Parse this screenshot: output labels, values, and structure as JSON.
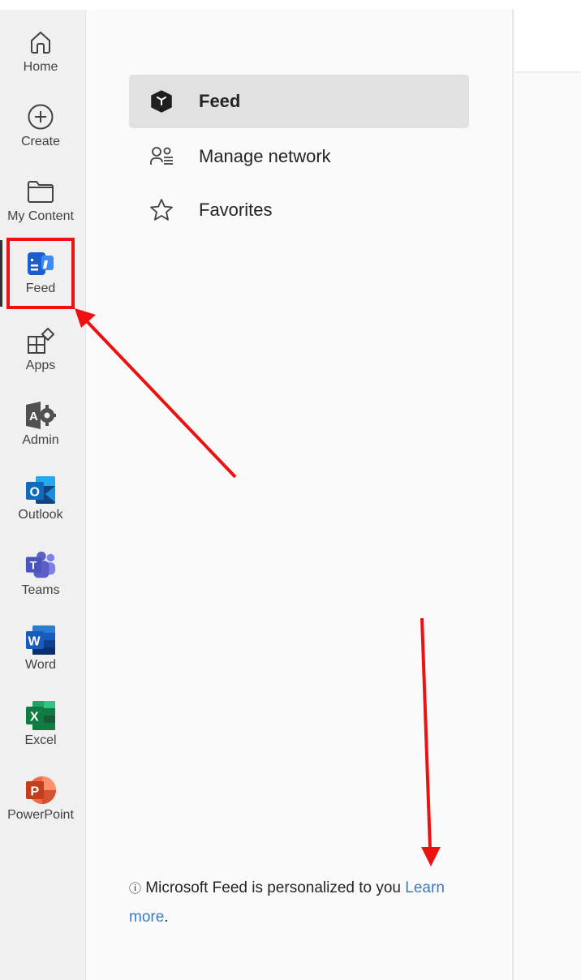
{
  "rail": {
    "items": [
      {
        "label": "Home",
        "icon": "home-icon"
      },
      {
        "label": "Create",
        "icon": "add-circle-icon"
      },
      {
        "label": "My Content",
        "icon": "folder-icon"
      },
      {
        "label": "Feed",
        "icon": "feed-icon"
      },
      {
        "label": "Apps",
        "icon": "apps-icon"
      },
      {
        "label": "Admin",
        "icon": "admin-icon"
      },
      {
        "label": "Outlook",
        "icon": "outlook-icon"
      },
      {
        "label": "Teams",
        "icon": "teams-icon"
      },
      {
        "label": "Word",
        "icon": "word-icon"
      },
      {
        "label": "Excel",
        "icon": "excel-icon"
      },
      {
        "label": "PowerPoint",
        "icon": "powerpoint-icon"
      }
    ],
    "active": "Feed"
  },
  "panel": {
    "items": [
      {
        "label": "Feed",
        "icon": "cube-icon"
      },
      {
        "label": "Manage network",
        "icon": "people-list-icon"
      },
      {
        "label": "Favorites",
        "icon": "star-icon"
      }
    ],
    "selected": "Feed",
    "footer": {
      "info_icon": "ⓘ",
      "text": "Microsoft Feed is personalized to you",
      "link": "Learn more",
      "trailing": "."
    }
  },
  "colors": {
    "annotation": "#ee1111",
    "link": "#3a7cc1",
    "word": "#185abd",
    "excel": "#107c41",
    "powerpoint": "#c43e1c",
    "outlook": "#0f6cbd",
    "teams": "#5b5fc7"
  }
}
